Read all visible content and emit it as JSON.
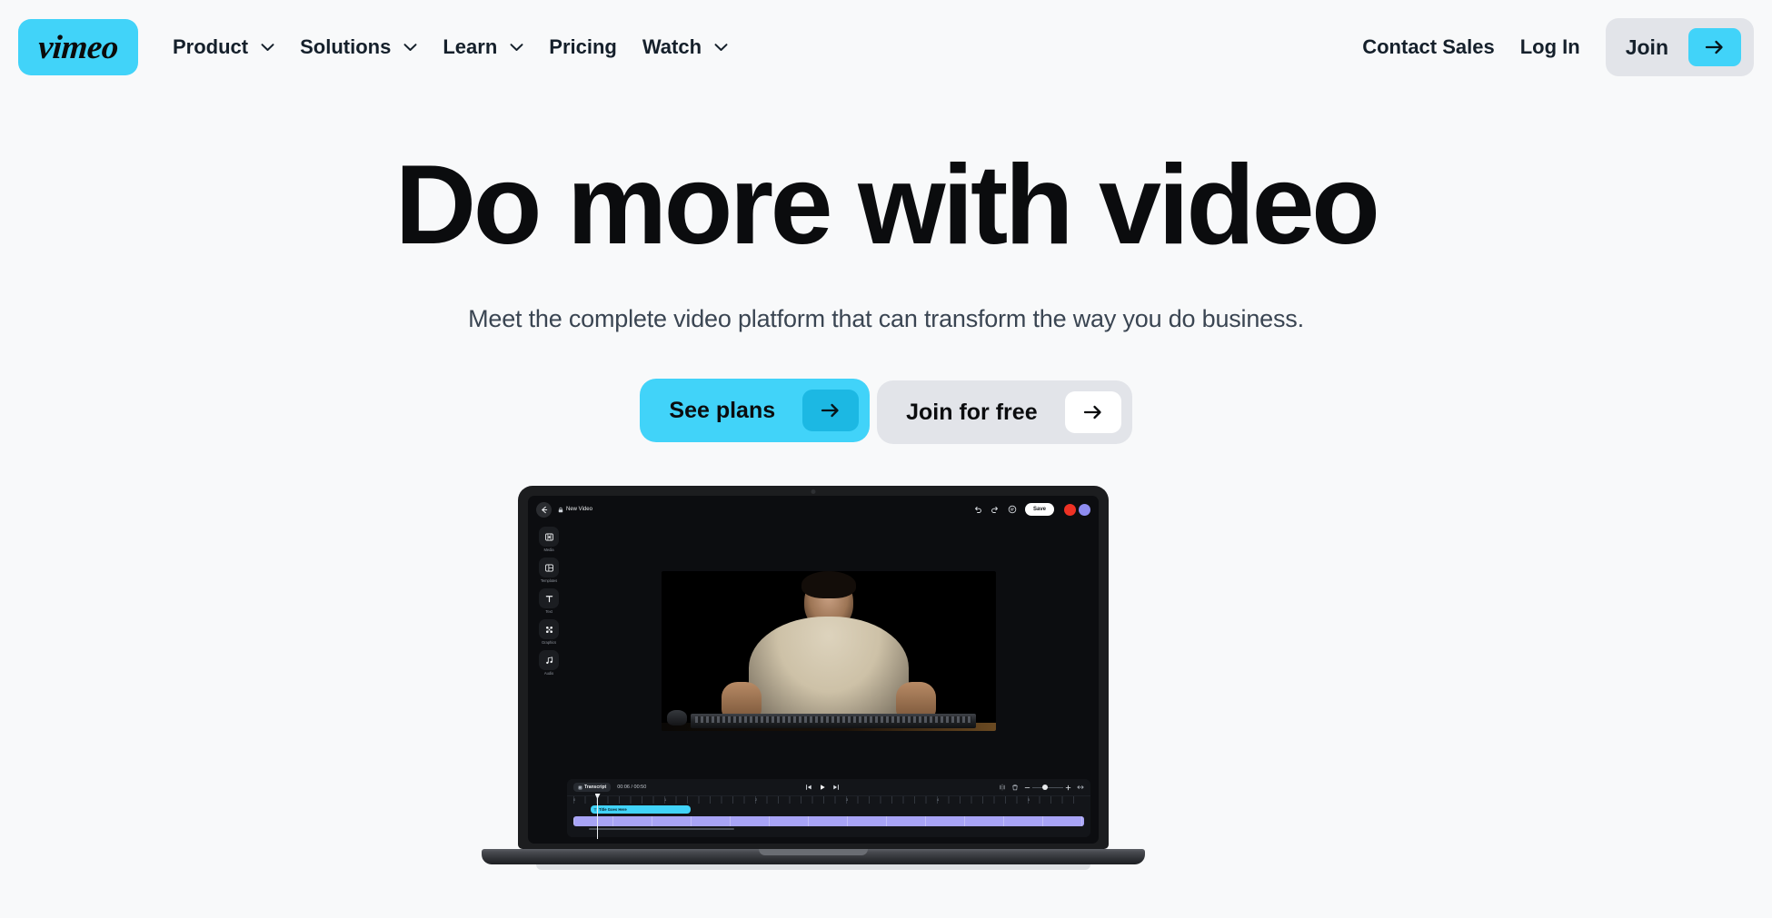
{
  "brand": {
    "name": "vimeo",
    "accent": "#41d3f9",
    "logo_bg": "#41d3f9"
  },
  "nav": {
    "items": [
      {
        "label": "Product",
        "has_dropdown": true,
        "icon": "chevron-down-icon"
      },
      {
        "label": "Solutions",
        "has_dropdown": true,
        "icon": "chevron-down-icon"
      },
      {
        "label": "Learn",
        "has_dropdown": true,
        "icon": "chevron-down-icon"
      },
      {
        "label": "Pricing",
        "has_dropdown": false
      },
      {
        "label": "Watch",
        "has_dropdown": true,
        "icon": "chevron-down-icon"
      }
    ],
    "contact_sales": "Contact Sales",
    "log_in": "Log In",
    "join": "Join",
    "join_arrow_icon": "arrow-right-icon"
  },
  "hero": {
    "title": "Do more with video",
    "subtitle": "Meet the complete video platform that can transform the way you do business.",
    "primary_cta": {
      "label": "See plans",
      "icon": "arrow-right-icon",
      "bg": "#41d3f9"
    },
    "secondary_cta": {
      "label": "Join for free",
      "icon": "arrow-right-icon",
      "bg": "#e2e4e9"
    }
  },
  "editor": {
    "back_icon": "arrow-left-icon",
    "lock_icon": "lock-icon",
    "document_name": "New Video",
    "undo_icon": "undo-icon",
    "redo_icon": "redo-icon",
    "comment_icon": "comment-icon",
    "save_label": "Save",
    "avatars": [
      {
        "name": "avatar-red",
        "color": "#ee3124"
      },
      {
        "name": "avatar-purple",
        "color": "#8e8cf0"
      }
    ],
    "tools": [
      {
        "label": "Media",
        "icon": "media-icon"
      },
      {
        "label": "Templates",
        "icon": "templates-icon"
      },
      {
        "label": "Text",
        "icon": "text-icon"
      },
      {
        "label": "Graphics",
        "icon": "graphics-icon"
      },
      {
        "label": "Audio",
        "icon": "audio-icon"
      }
    ],
    "timeline": {
      "transcript_label": "Transcript",
      "transcript_icon": "transcript-icon",
      "current_time": "00:06",
      "total_time": "00:50",
      "time_display": "00:06 / 00:50",
      "prev_frame_icon": "skip-previous-icon",
      "play_icon": "play-icon",
      "next_frame_icon": "skip-next-icon",
      "split_icon": "split-icon",
      "delete_icon": "trash-icon",
      "zoom_out_icon": "minus-icon",
      "zoom_in_icon": "plus-icon",
      "fit_icon": "fit-to-screen-icon",
      "ruler_labels": [
        "0",
        "1",
        "2",
        "3",
        "4",
        "5"
      ],
      "text_clip_label": "Title Goes Here",
      "text_clip_icon": "text-clip-icon",
      "text_clip_color": "#41d3f9",
      "video_track_color": "#a8a4f6"
    }
  }
}
